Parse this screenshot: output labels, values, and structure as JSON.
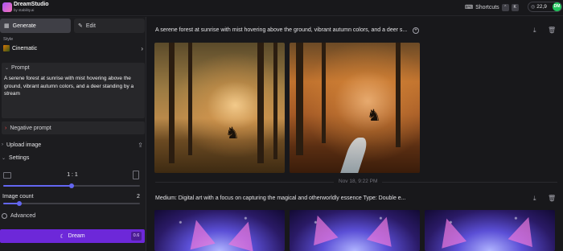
{
  "app": {
    "name": "DreamStudio",
    "by": "by stability.ai"
  },
  "header": {
    "shortcuts_label": "Shortcuts",
    "shortcut_keys": [
      "⌃",
      "K"
    ],
    "credits": "22,9",
    "avatar_initials": "DM"
  },
  "sidebar": {
    "tabs": [
      {
        "label": "Generate",
        "icon": "generate-icon",
        "active": true
      },
      {
        "label": "Edit",
        "icon": "edit-icon",
        "active": false
      }
    ],
    "style_label": "Style",
    "style_value": "Cinematic",
    "prompt_label": "Prompt",
    "prompt_text": "A serene forest at sunrise with mist hovering above the ground, vibrant autumn colors, and a deer standing by a stream",
    "negative_prompt_label": "Negative prompt",
    "upload_image_label": "Upload image",
    "settings_label": "Settings",
    "aspect_ratio": "1 : 1",
    "aspect_ratio_slider_fraction": 0.5,
    "image_count_label": "Image count",
    "image_count": "2",
    "image_count_slider_fraction": 0.12,
    "advanced_label": "Advanced",
    "dream_label": "Dream",
    "dream_cost": "0.6"
  },
  "main": {
    "generations": [
      {
        "prompt": "A serene forest at sunrise with mist hovering above the ground, vibrant autumn colors, and a deer s...",
        "images": 2
      },
      {
        "prompt": "Medium: Digital art with a focus on capturing the magical and otherworldly essence Type: Double e...",
        "images": 3
      }
    ],
    "date_separator": "Nov 18, 9:22 PM"
  },
  "colors": {
    "accent": "#6d28d9",
    "slider": "#6366f1",
    "background": "#18181b",
    "avatar": "#22c55e"
  }
}
